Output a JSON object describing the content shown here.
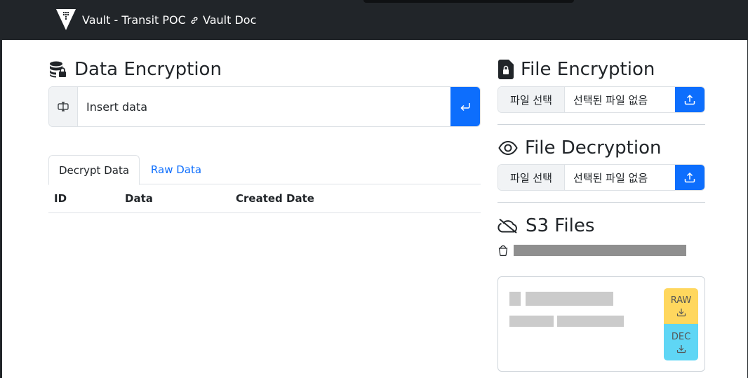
{
  "navbar": {
    "brand": "Vault - Transit POC",
    "doc_link": "Vault Doc"
  },
  "data_encryption": {
    "title": "Data Encryption",
    "input_placeholder": "Insert data"
  },
  "tabs": [
    {
      "label": "Decrypt Data",
      "active": true
    },
    {
      "label": "Raw Data",
      "active": false
    }
  ],
  "table": {
    "columns": [
      "ID",
      "Data",
      "Created Date"
    ],
    "rows": []
  },
  "file_encryption": {
    "title": "File Encryption",
    "choose_label": "파일 선택",
    "no_file_label": "선택된 파일 없음"
  },
  "file_decryption": {
    "title": "File Decryption",
    "choose_label": "파일 선택",
    "no_file_label": "선택된 파일 없음"
  },
  "s3_files": {
    "title": "S3 Files",
    "raw_label": "RAW",
    "dec_label": "DEC"
  },
  "colors": {
    "navbar": "#212529",
    "primary": "#0d6efd",
    "raw_button": "#ffd75e",
    "dec_button": "#5fd6f5"
  }
}
